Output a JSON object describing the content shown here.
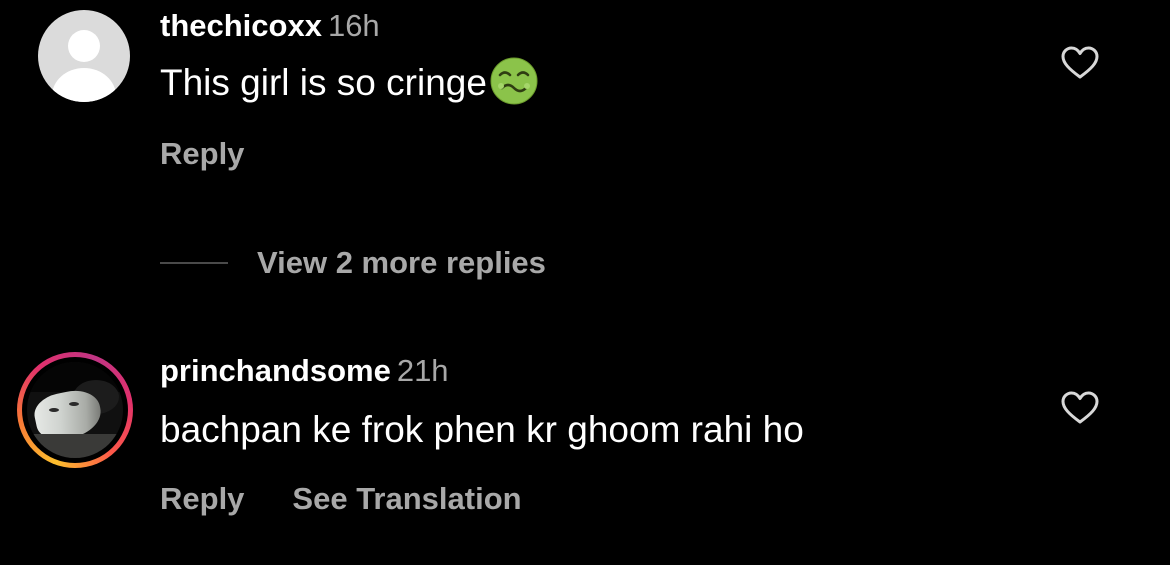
{
  "comments": [
    {
      "username": "thechicoxx",
      "time": "16h",
      "text": "This girl is so cringe",
      "emoji_icon": "nauseated-face-icon",
      "reply_label": "Reply",
      "like_icon": "heart-outline-icon",
      "avatar": "default-avatar"
    },
    {
      "username": "princhandsome",
      "time": "21h",
      "text": "bachpan ke frok phen kr ghoom rahi ho",
      "reply_label": "Reply",
      "translate_label": "See Translation",
      "like_icon": "heart-outline-icon",
      "avatar": "photo-avatar-with-story-ring"
    }
  ],
  "view_replies": {
    "label": "View 2 more replies"
  },
  "colors": {
    "background": "#000000",
    "primary_text": "#ffffff",
    "secondary_text": "#a8a8a8",
    "story_ring": [
      "#fdbf2d",
      "#e1306c",
      "#c13584"
    ],
    "emoji_green": "#8bc34a"
  }
}
